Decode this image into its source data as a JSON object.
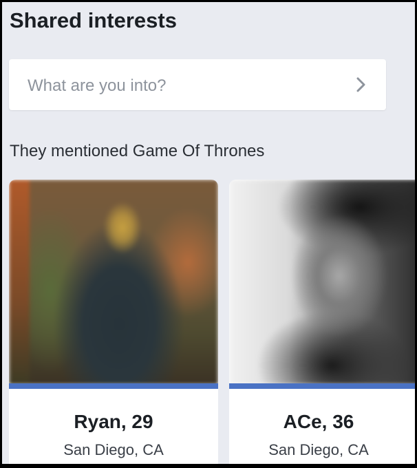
{
  "section_title": "Shared interests",
  "search": {
    "placeholder": "What are you into?",
    "chevron_icon": "chevron-right-icon"
  },
  "subheading": "They mentioned Game Of Thrones",
  "accent_color": "#4a72c4",
  "cards": [
    {
      "name": "Ryan, 29",
      "location": "San Diego, CA"
    },
    {
      "name": "ACe, 36",
      "location": "San Diego, CA"
    }
  ]
}
